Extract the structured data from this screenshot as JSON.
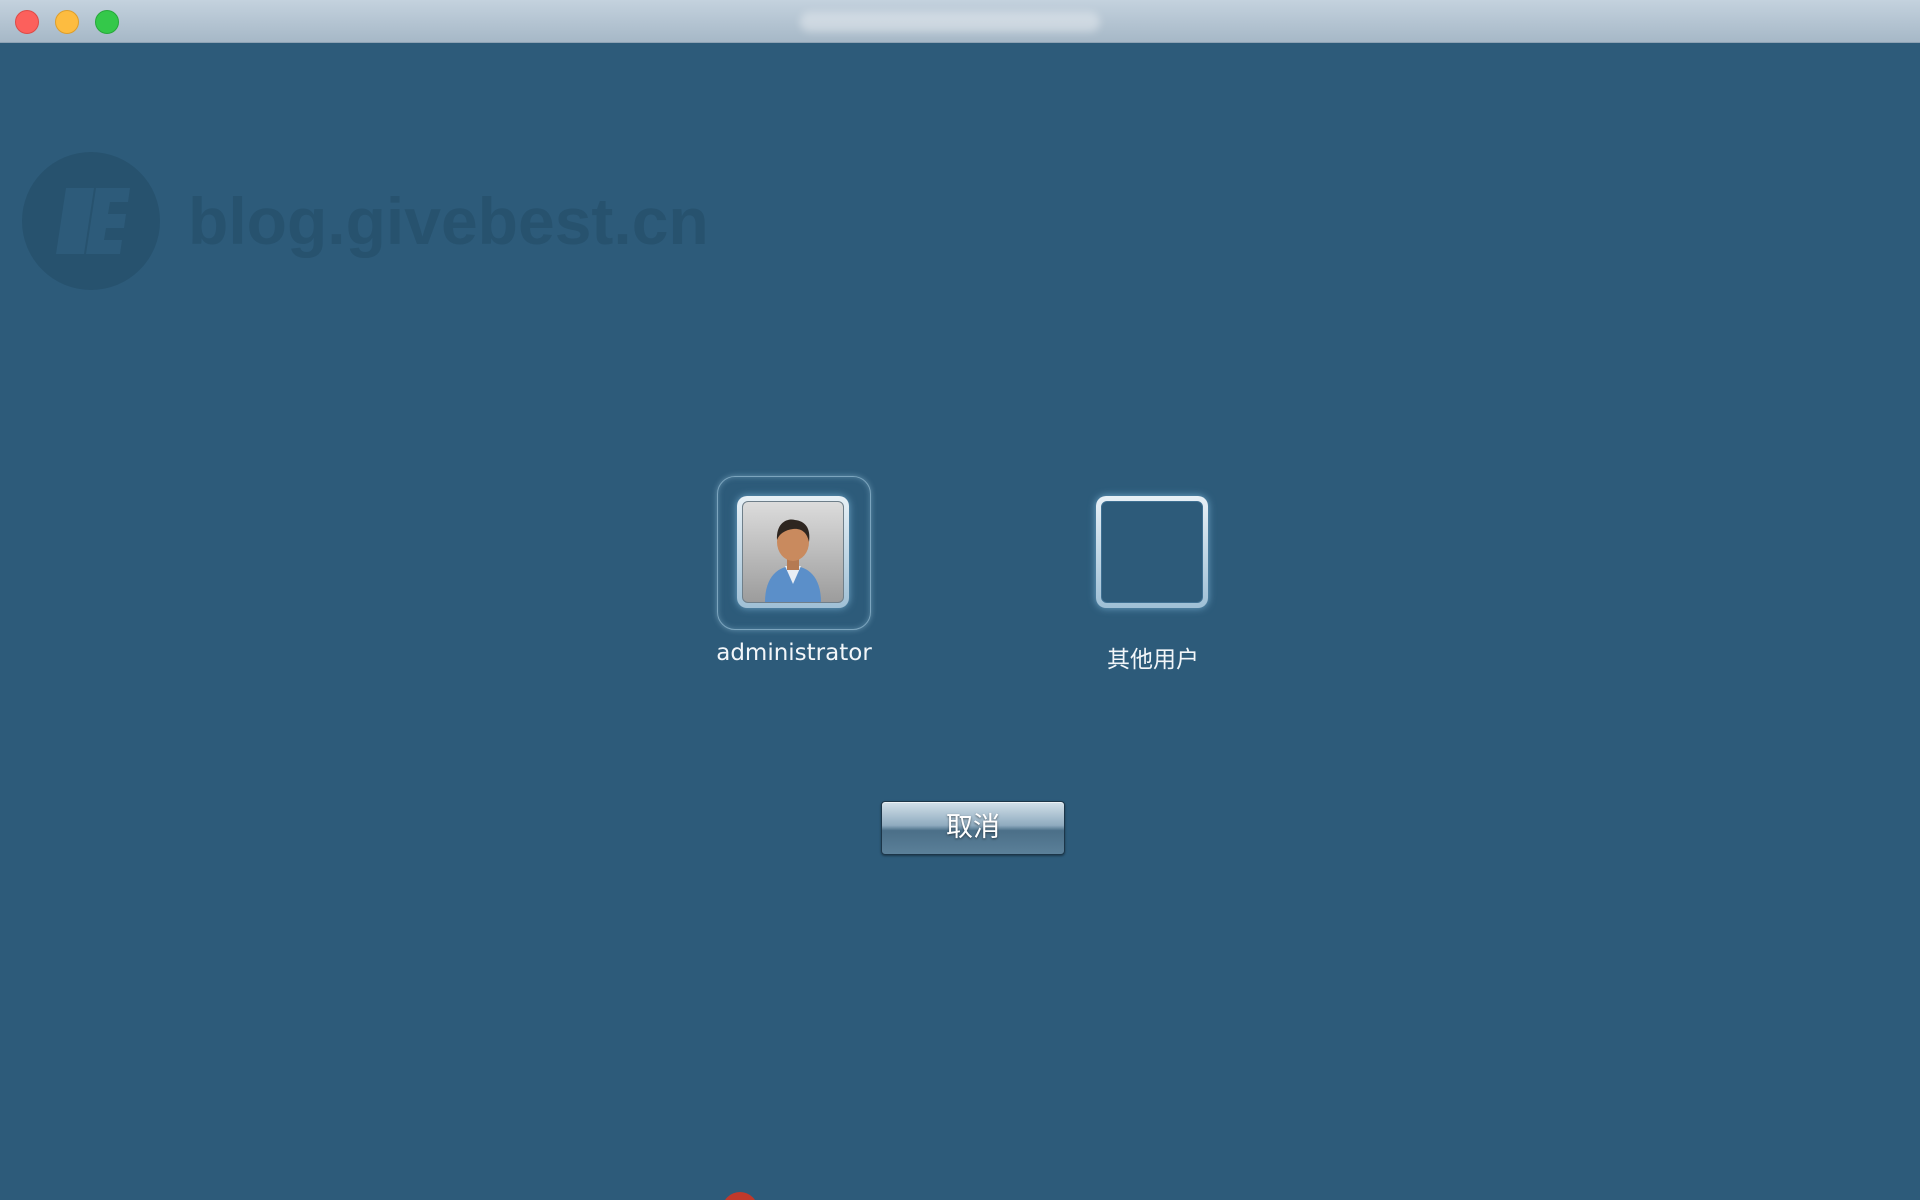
{
  "watermark": {
    "text": "blog.givebest.cn"
  },
  "users": [
    {
      "label": "administrator",
      "icon": "user-avatar-icon"
    },
    {
      "label": "其他用户",
      "icon": "empty-avatar"
    }
  ],
  "actions": {
    "cancel_label": "取消"
  },
  "colors": {
    "background": "#2d5b7a",
    "watermark": "#27526e"
  }
}
